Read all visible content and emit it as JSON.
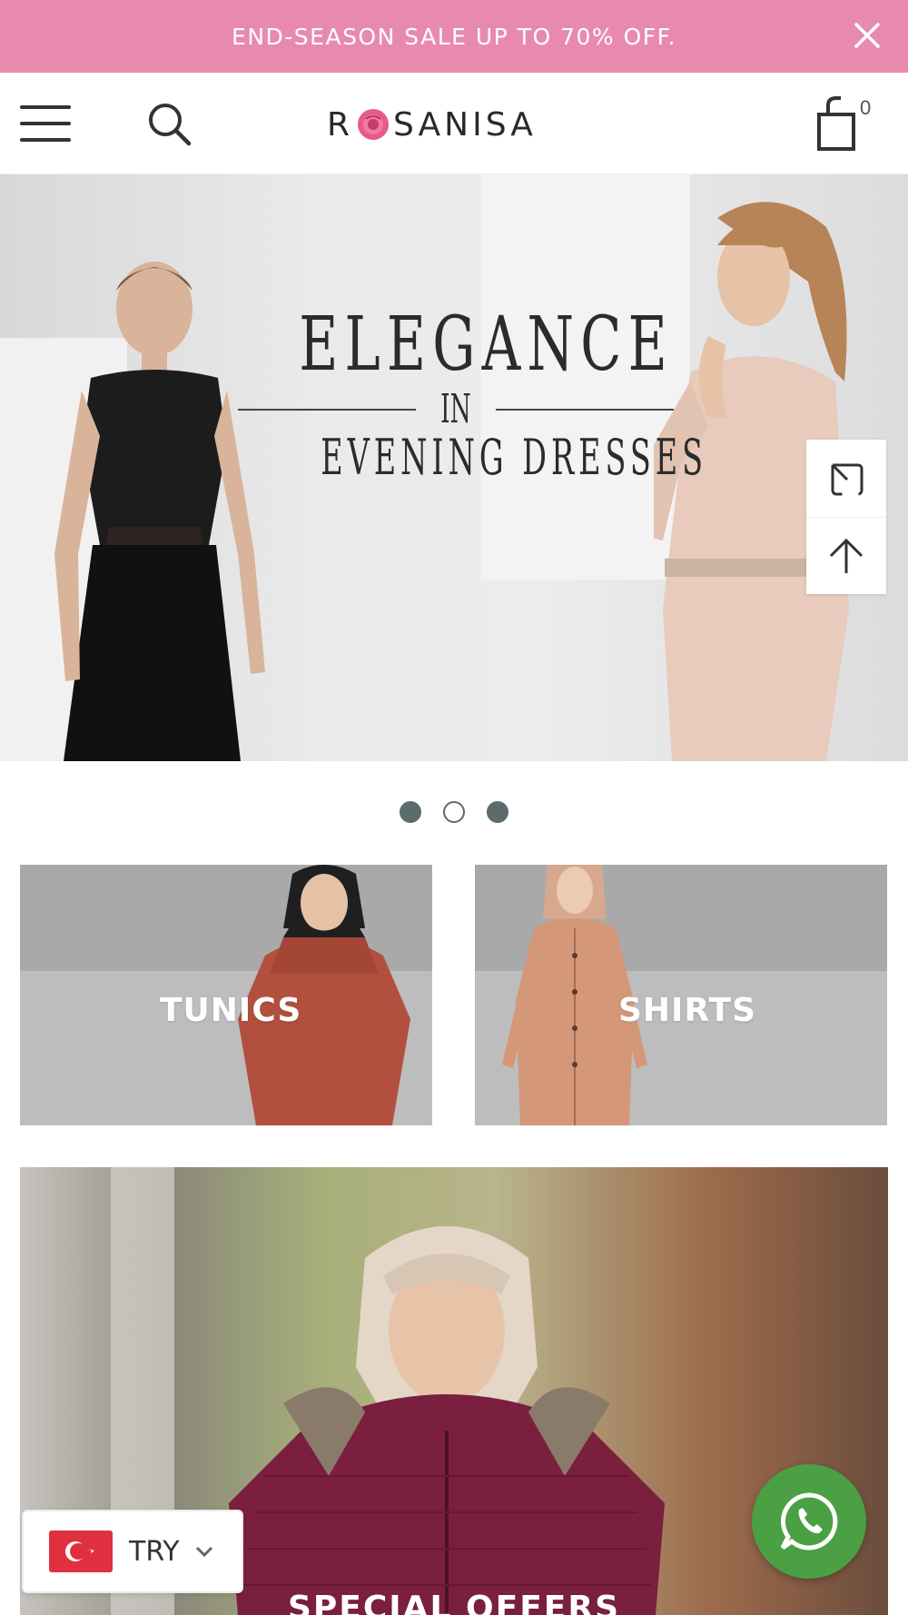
{
  "announcement": {
    "text": "END-SEASON SALE UP TO 70% OFF."
  },
  "header": {
    "logo_left": "R",
    "logo_right": "SANISA",
    "cart_count": "0"
  },
  "hero": {
    "line1": "ELEGANCE",
    "line2": "IN",
    "line3": "EVENING DRESSES",
    "slides": 3,
    "active_slide": 2
  },
  "categories": [
    {
      "label": "TUNICS"
    },
    {
      "label": "SHIRTS"
    }
  ],
  "promo": {
    "label": "SPECIAL OFFERS"
  },
  "currency": {
    "code": "TRY"
  },
  "colors": {
    "announcement_bg": "#e88aae",
    "whatsapp": "#4aa043",
    "dot": "#5c6b6b"
  },
  "icons": [
    "close-icon",
    "menu-icon",
    "search-icon",
    "cart-icon",
    "expand-icon",
    "arrow-up-icon",
    "chevron-down-icon",
    "whatsapp-icon",
    "turkey-flag-icon",
    "rose-logo-icon"
  ]
}
